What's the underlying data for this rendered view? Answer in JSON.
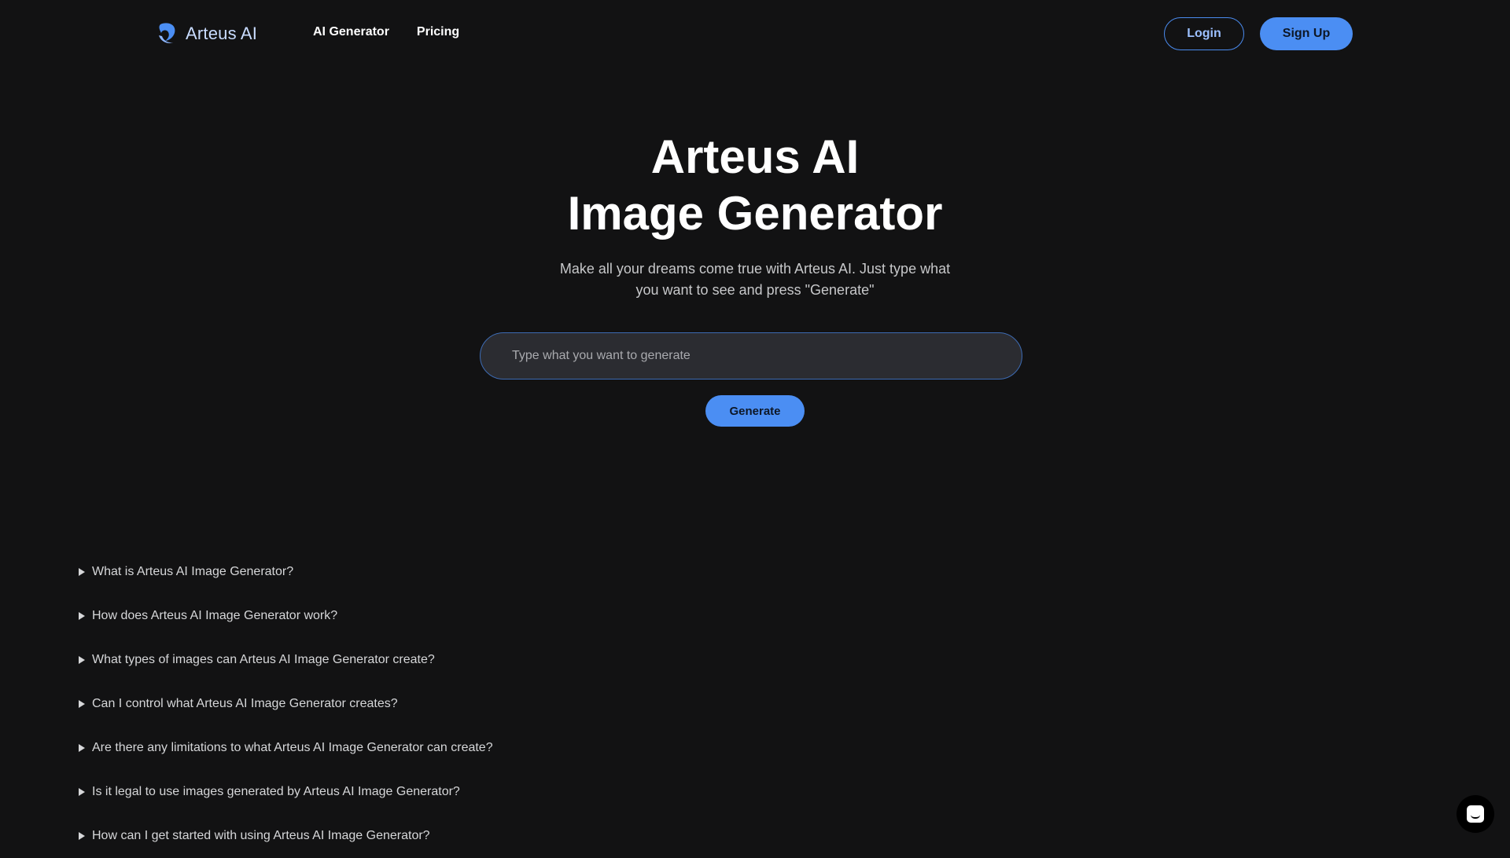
{
  "header": {
    "brand": "Arteus AI",
    "nav": [
      {
        "label": "AI Generator"
      },
      {
        "label": "Pricing"
      }
    ],
    "login_label": "Login",
    "signup_label": "Sign Up"
  },
  "hero": {
    "title_line1": "Arteus AI",
    "title_line2": "Image Generator",
    "subtitle": "Make all your dreams come true with Arteus AI. Just type what you want to see and press \"Generate\"",
    "input_placeholder": "Type what you want to generate",
    "input_value": "",
    "generate_label": "Generate"
  },
  "faq": [
    {
      "question": "What is Arteus AI Image Generator?"
    },
    {
      "question": "How does Arteus AI Image Generator work?"
    },
    {
      "question": "What types of images can Arteus AI Image Generator create?"
    },
    {
      "question": "Can I control what Arteus AI Image Generator creates?"
    },
    {
      "question": "Are there any limitations to what Arteus AI Image Generator can create?"
    },
    {
      "question": "Is it legal to use images generated by Arteus AI Image Generator?"
    },
    {
      "question": "How can I get started with using Arteus AI Image Generator?"
    }
  ],
  "icons": {
    "logo": "swirl-logo-icon",
    "faq_toggle": "triangle-right-icon",
    "chat": "chat-bubble-icon"
  },
  "colors": {
    "background": "#121213",
    "accent": "#4b8ef3",
    "brand_text": "#c9dcff"
  }
}
